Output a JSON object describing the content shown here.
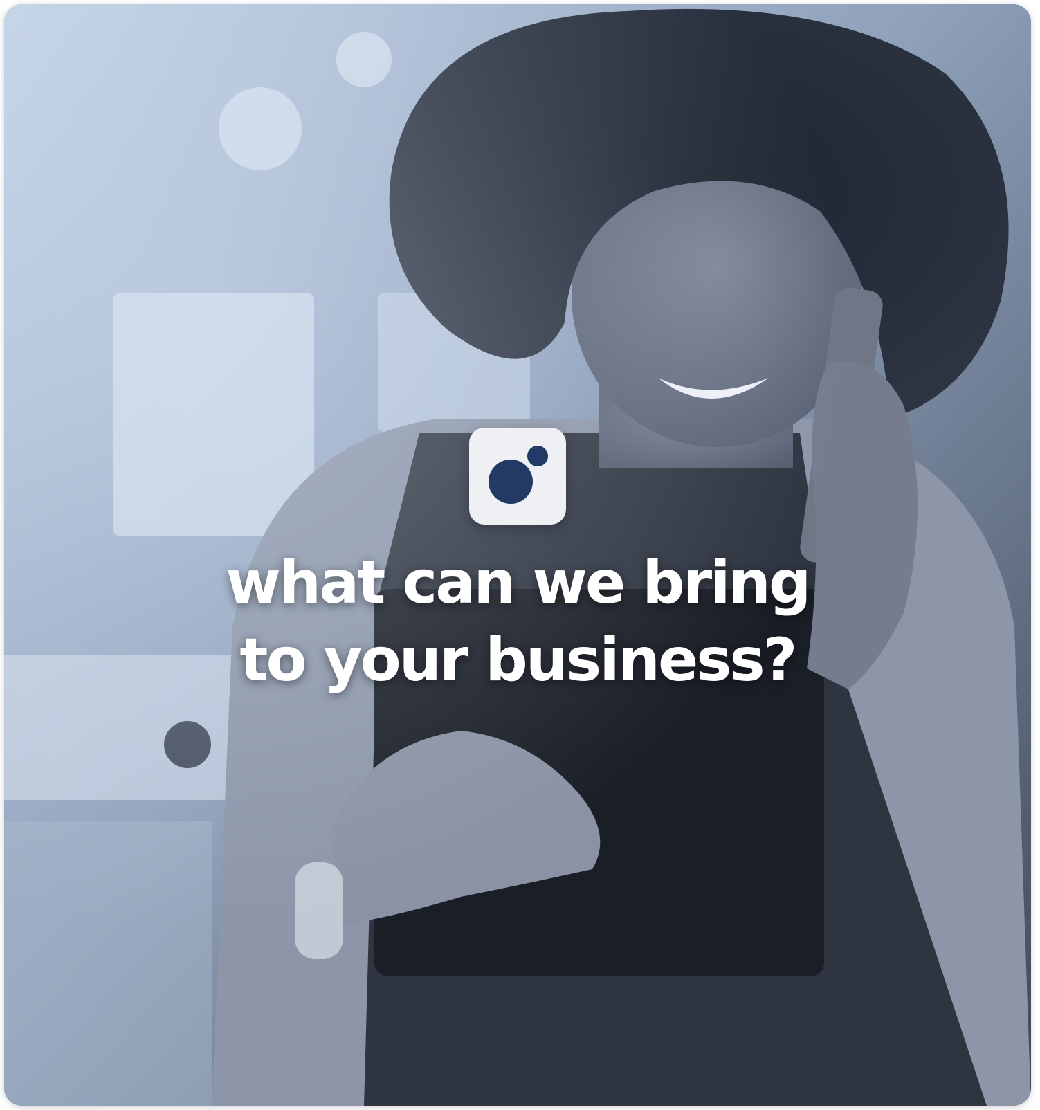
{
  "card": {
    "headline_line1": "what can we bring",
    "headline_line2": "to your business?",
    "logo_icon": "bubbles-logo-icon",
    "colors": {
      "logo_background": "#eef0f4",
      "logo_dots": "#233a66",
      "headline_text": "#ffffff",
      "photo_tint": "#9aacc4"
    }
  }
}
